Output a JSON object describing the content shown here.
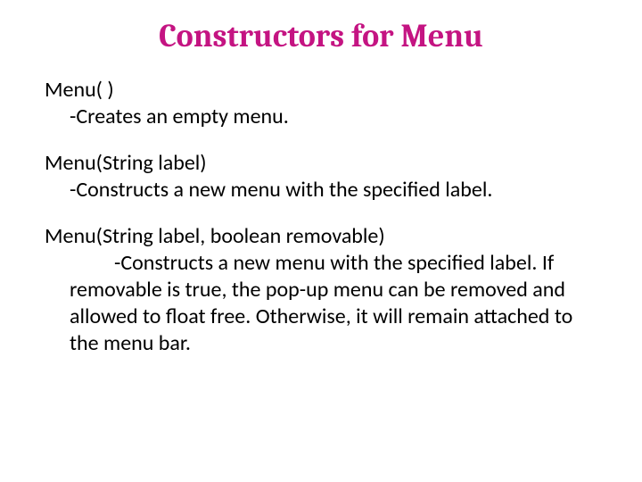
{
  "title": "Constructors for Menu",
  "constructors": [
    {
      "signature": "Menu( )",
      "description": "-Creates an empty menu."
    },
    {
      "signature": "Menu(String label)",
      "description": "-Constructs a new menu with the specified label."
    },
    {
      "signature": "Menu(String label, boolean removable)",
      "description": "-Constructs a new menu with the specified label. If removable is true, the pop-up menu can be removed and allowed to float free. Otherwise, it will remain attached to the menu bar."
    }
  ]
}
